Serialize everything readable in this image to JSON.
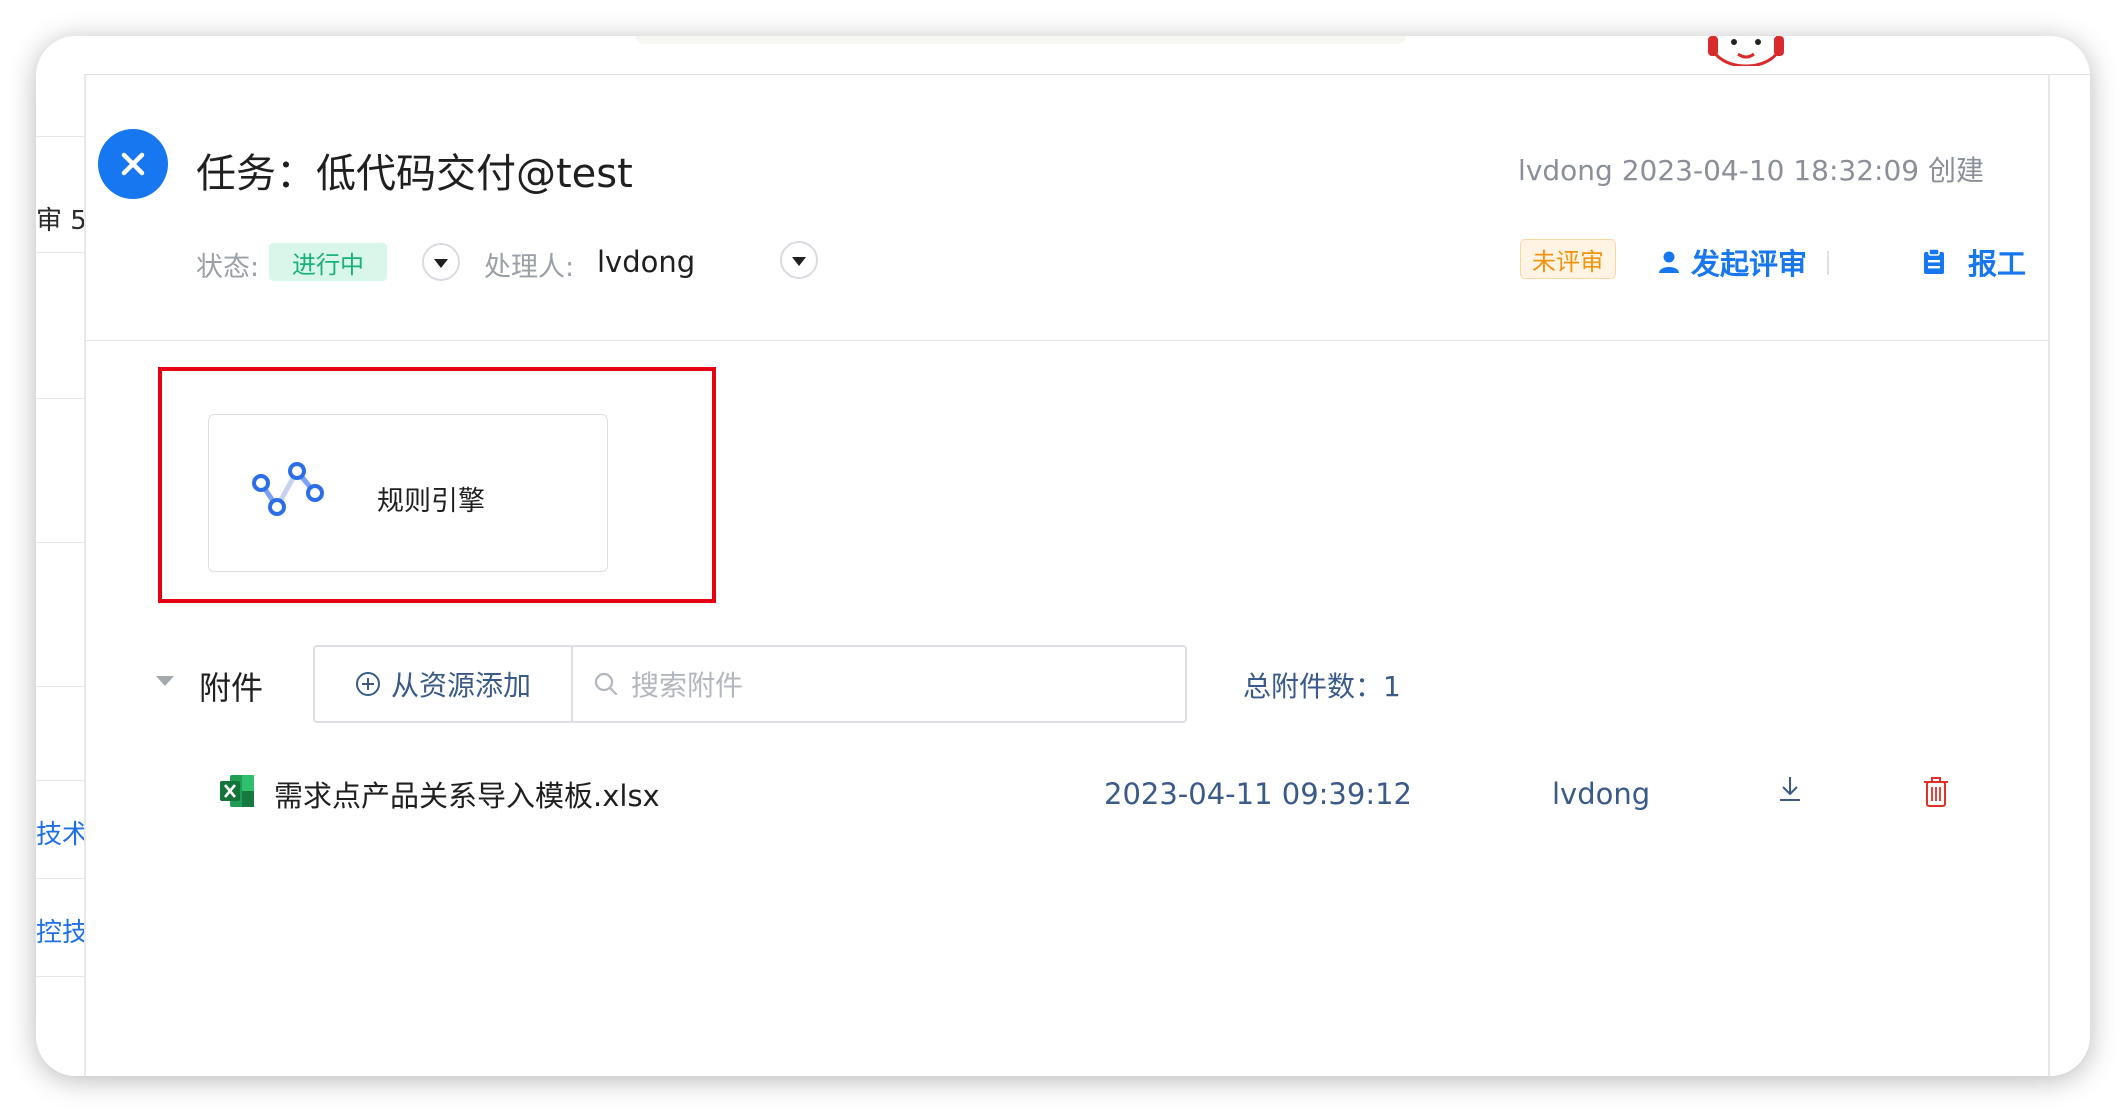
{
  "background": {
    "row_texts": [
      "审 5",
      "技术",
      "控技"
    ]
  },
  "task": {
    "close_label": "关闭",
    "title": "任务：低代码交付@test",
    "created": "lvdong 2023-04-10 18:32:09 创建",
    "status_label": "状态:",
    "status_value": "进行中",
    "assignee_label": "处理人:",
    "assignee": "lvdong",
    "review_tag": "未评审",
    "start_review": "发起评审",
    "report_work": "报工"
  },
  "module_card": {
    "label": "规则引擎"
  },
  "attachments": {
    "title": "附件",
    "add_label": "从资源添加",
    "search_placeholder": "搜索附件",
    "count_text": "总附件数：1",
    "files": [
      {
        "name": "需求点产品关系导入模板.xlsx",
        "date": "2023-04-11 09:39:12",
        "owner": "lvdong"
      }
    ]
  },
  "colors": {
    "primary": "#1677f0",
    "status_green": "#16b277",
    "review_orange": "#f0940f",
    "highlight_red": "#e60012"
  }
}
